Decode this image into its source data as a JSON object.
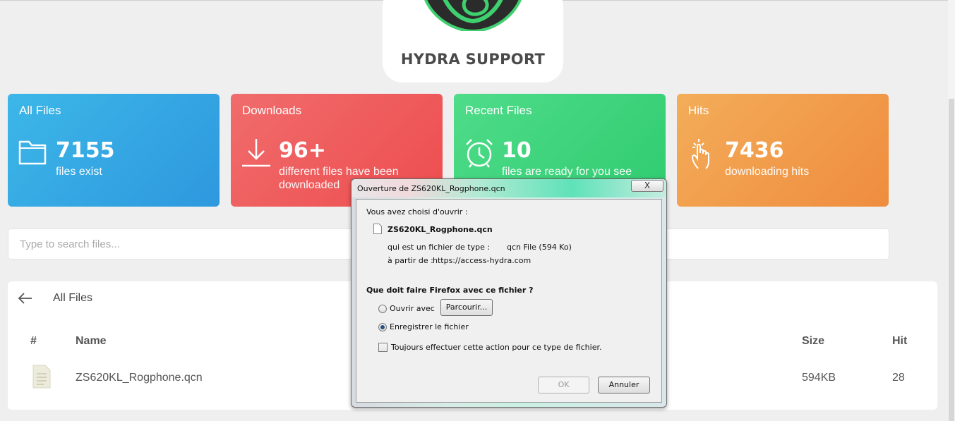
{
  "logo": {
    "text": "HYDRA SUPPORT"
  },
  "stats": [
    {
      "title": "All Files",
      "value": "7155",
      "sub": "files exist",
      "icon": "folder-icon"
    },
    {
      "title": "Downloads",
      "value": "96+",
      "sub": "different files have been downloaded",
      "icon": "download-icon"
    },
    {
      "title": "Recent Files",
      "value": "10",
      "sub": "files are ready for you see",
      "icon": "alarm-clock-icon"
    },
    {
      "title": "Hits",
      "value": "7436",
      "sub": "downloading hits",
      "icon": "pointer-hand-icon"
    }
  ],
  "search": {
    "placeholder": "Type to search files..."
  },
  "files_panel": {
    "title": "All Files",
    "columns": {
      "num": "#",
      "name": "Name",
      "size": "Size",
      "hit": "Hit"
    },
    "rows": [
      {
        "name": "ZS620KL_Rogphone.qcn",
        "size": "594KB",
        "hit": "28"
      }
    ]
  },
  "dialog": {
    "title": "Ouverture de ZS620KL_Rogphone.qcn",
    "close_label": "X",
    "intro": "Vous avez choisi d'ouvrir :",
    "filename": "ZS620KL_Rogphone.qcn",
    "type_label": "qui est un fichier de type :",
    "type_value": "qcn File (594 Ko)",
    "from_label": "à partir de :",
    "from_value": "https://access-hydra.com",
    "question": "Que doit faire Firefox avec ce fichier ?",
    "open_with_label": "Ouvrir avec",
    "browse_label": "Parcourir...",
    "save_label": "Enregistrer le fichier",
    "always_label": "Toujours effectuer cette action pour ce type de fichier.",
    "ok_label": "OK",
    "cancel_label": "Annuler",
    "selected_option": "Enregistrer le fichier"
  }
}
